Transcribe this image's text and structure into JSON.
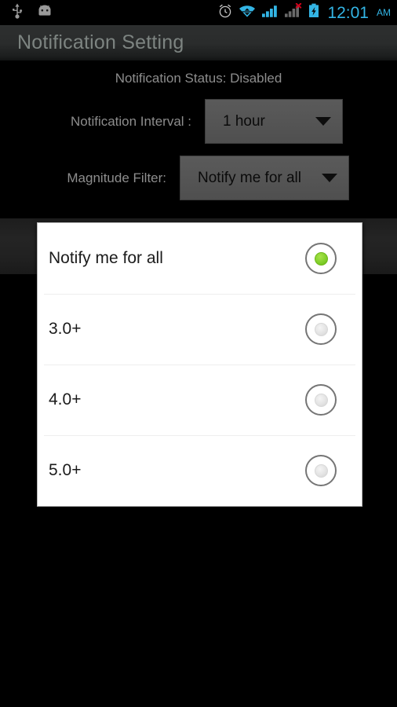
{
  "statusbar": {
    "icons_left": [
      "usb-icon",
      "android-debug-icon"
    ],
    "icons_right": [
      "alarm-icon",
      "wifi-icon",
      "signal-icon",
      "signal-no-service-icon",
      "battery-charging-icon"
    ],
    "time": "12:01",
    "ampm": "AM",
    "accent_color": "#33b5e5"
  },
  "titlebar": {
    "title": "Notification Setting"
  },
  "main": {
    "status_line": "Notification Status: Disabled",
    "interval": {
      "label": "Notification Interval :",
      "value": "1 hour"
    },
    "magnitude": {
      "label": "Magnitude Filter:",
      "value": "Notify me for all"
    }
  },
  "dropdown": {
    "name": "magnitude-filter-options",
    "selected_index": 0,
    "selected_color": "#7ccc27",
    "options": [
      {
        "label": "Notify me for all"
      },
      {
        "label": "3.0+"
      },
      {
        "label": "4.0+"
      },
      {
        "label": "5.0+"
      }
    ]
  }
}
